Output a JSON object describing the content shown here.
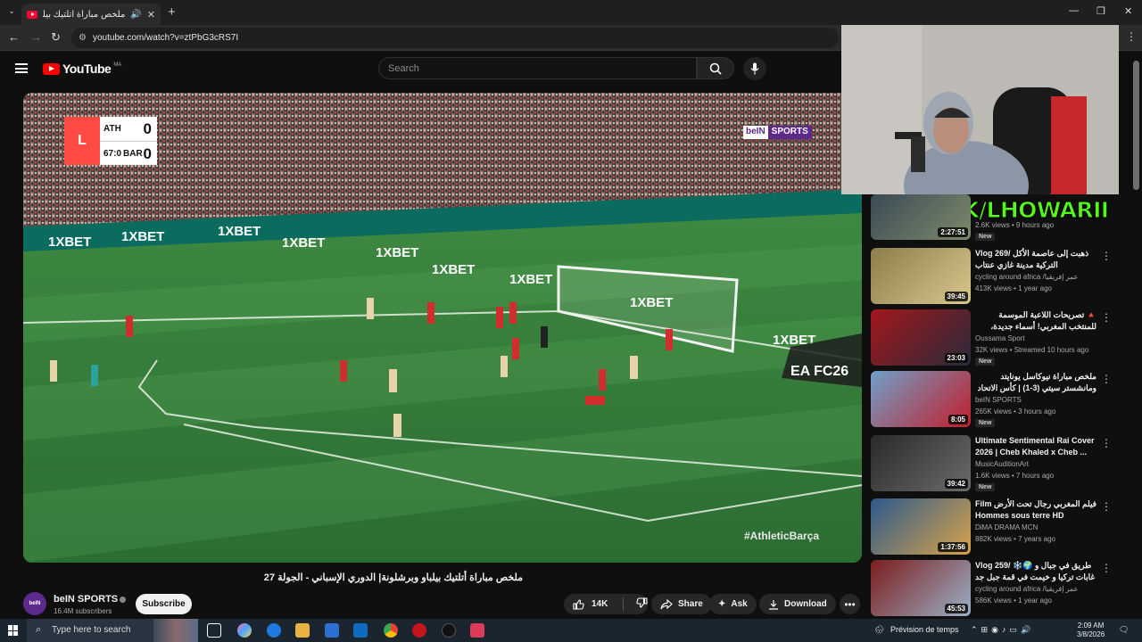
{
  "browser": {
    "tab_title": "ملخص مباراة أتلتيك بيلباو وبرشلونة",
    "tab_close": "✕",
    "new_tab": "+",
    "url": "youtube.com/watch?v=ztPbG3cRS7I",
    "win_min": "—",
    "win_max": "❐",
    "win_close": "✕"
  },
  "youtube": {
    "logo_text": "YouTube",
    "country_code": "MA",
    "search_placeholder": "Search"
  },
  "video": {
    "score": {
      "team_home": "ATH",
      "team_away": "BAR",
      "score_home": "0",
      "score_away": "0",
      "clock": "67:05",
      "league_logo": "L"
    },
    "broadcaster_a": "beIN",
    "broadcaster_b": "SPORTS",
    "hashtag": "#AthleticBarça",
    "ad_boards": [
      "1XBET",
      "1XBET",
      "1XBET",
      "1XBET",
      "1XBET",
      "1XBET",
      "1XBET",
      "1XBET",
      "1XBET"
    ],
    "ea_text": "EA FC26"
  },
  "meta": {
    "title": "ملخص مباراة أتلتيك بيلباو وبرشلونة| الدوري الإسباني - الجولة 27",
    "channel": "beIN SPORTS",
    "subscribers": "16.4M subscribers",
    "avatar_text": "beIN",
    "subscribe": "Subscribe",
    "likes": "14K",
    "share": "Share",
    "ask": "Ask",
    "download": "Download",
    "more": "•••"
  },
  "kick": {
    "logo": "K",
    "text": "KICK/LHOWARII"
  },
  "sidebar": [
    {
      "title": "",
      "channel": "",
      "views": "2.6K views • 9 hours ago",
      "duration": "2:27:51",
      "badge": "New",
      "colors": [
        "#3a4a55",
        "#7d8a6a"
      ],
      "title_rtl": false
    },
    {
      "title": "Vlog 269/ ذهبت إلى عاصمة الأكل التركية مدينة غازي عنتاب",
      "channel": "cycling around africa /عمر إفريقيا",
      "views": "413K views • 1 year ago",
      "duration": "39:45",
      "badge": "",
      "colors": [
        "#8c7d4a",
        "#d8c78e"
      ],
      "title_rtl": false
    },
    {
      "title": "🔺 تصريحات اللاعبة الموسمة للمنتخب المغربي! أسماء جديدة، مدرب اسبانيا يحذر ...",
      "channel": "Oussama Sport",
      "views": "32K views • Streamed 10 hours ago",
      "duration": "23:03",
      "badge": "New",
      "colors": [
        "#a3171c",
        "#2a2a3a"
      ],
      "title_rtl": true
    },
    {
      "title": "ملخص مباراة نيوكاسل يونايتد ومانشستر سيتي (3-1) | كأس الاتحاد الإنجليزي - الدور ...",
      "channel": "beIN SPORTS",
      "views": "265K views • 3 hours ago",
      "duration": "8:05",
      "badge": "New",
      "colors": [
        "#6fa0c8",
        "#c21e2c"
      ],
      "title_rtl": true
    },
    {
      "title": "Ultimate Sentimental Rai Cover 2026 | Cheb Khaled x Cheb ...",
      "channel": "MusicAuditionArt",
      "views": "1.6K views • 7 hours ago",
      "duration": "39:42",
      "badge": "New",
      "colors": [
        "#2a2a2a",
        "#6b6b6b"
      ],
      "title_rtl": false
    },
    {
      "title": "Film فيلم المغربي رجال تحت الأرض Hommes sous terre HD",
      "channel": "DiMA DRAMA MCN",
      "views": "882K views • 7 years ago",
      "duration": "1:37:56",
      "badge": "",
      "colors": [
        "#2d5a8c",
        "#d7a24a"
      ],
      "title_rtl": false
    },
    {
      "title": "Vlog 259/ ❄️🌍 طريق في جبال و غابات تركيا و خيمت في قمة جبل جد باردة",
      "channel": "cycling around africa /عمر إفريقيا",
      "views": "586K views • 1 year ago",
      "duration": "45:53",
      "badge": "",
      "colors": [
        "#7c1d1d",
        "#9ab0c8"
      ],
      "title_rtl": false
    }
  ],
  "taskbar": {
    "search_placeholder": "Type here to search",
    "weather": "Prévision de temps",
    "time": "2:09 AM",
    "date": "3/8/2026"
  }
}
